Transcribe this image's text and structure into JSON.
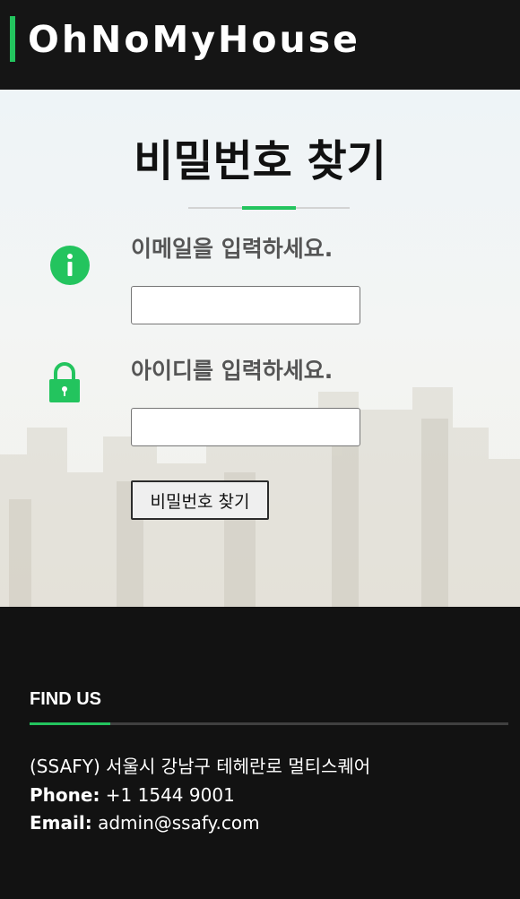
{
  "header": {
    "brand": "OhNoMyHouse"
  },
  "form": {
    "title": "비밀번호 찾기",
    "email_label": "이메일을 입력하세요.",
    "email_value": "",
    "id_label": "아이디를 입력하세요.",
    "id_value": "",
    "submit_label": "비밀번호 찾기"
  },
  "footer": {
    "heading": "FIND US",
    "address": "(SSAFY) 서울시 강남구 테헤란로 멀티스퀘어",
    "phone_label": "Phone:",
    "phone_value": "+1 1544 9001",
    "email_label": "Email:",
    "email_value": "admin@ssafy.com"
  },
  "icons": {
    "email": "info-icon",
    "id": "lock-icon"
  },
  "colors": {
    "accent": "#23c45e",
    "header_bg": "#151515",
    "footer_bg": "#121212"
  }
}
